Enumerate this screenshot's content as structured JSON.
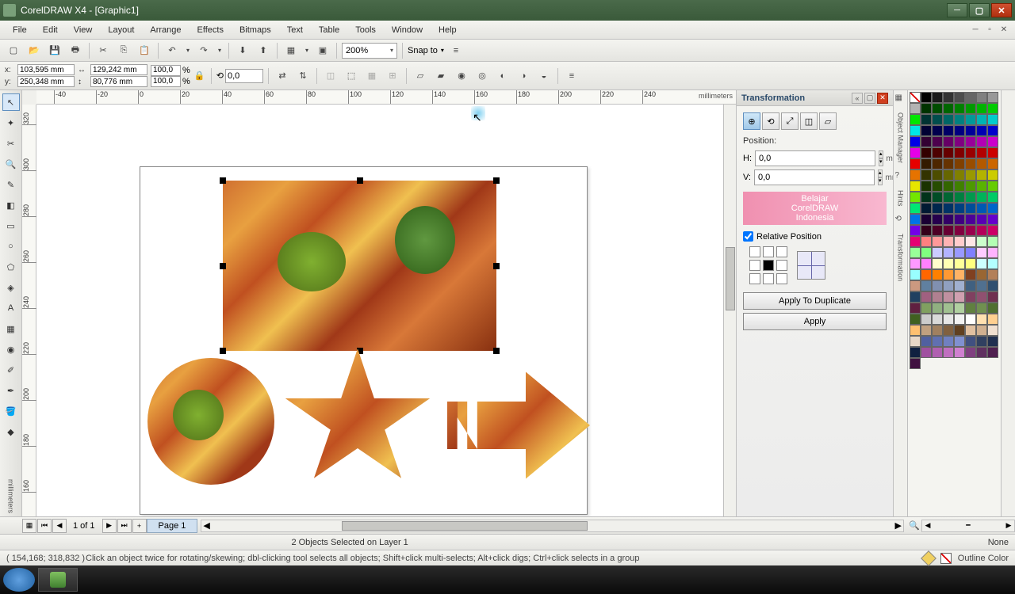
{
  "title": "CorelDRAW X4 - [Graphic1]",
  "menu": [
    "File",
    "Edit",
    "View",
    "Layout",
    "Arrange",
    "Effects",
    "Bitmaps",
    "Text",
    "Table",
    "Tools",
    "Window",
    "Help"
  ],
  "toolbar": {
    "zoom": "200%",
    "snap": "Snap to"
  },
  "prop": {
    "x": "103,595 mm",
    "y": "250,348 mm",
    "w": "129,242 mm",
    "h": "80,776 mm",
    "sx": "100,0",
    "sy": "100,0",
    "su": "%",
    "rot": "0,0"
  },
  "ruler": {
    "unit": "millimeters",
    "h": [
      -40,
      -20,
      0,
      20,
      40,
      60,
      80,
      100,
      120,
      140,
      160,
      180,
      200,
      220,
      240
    ],
    "v": [
      320,
      300,
      280,
      260,
      240,
      220,
      200,
      180,
      160
    ]
  },
  "docker": {
    "title": "Transformation",
    "section": "Position:",
    "h_label": "H:",
    "h_val": "0,0",
    "v_label": "V:",
    "v_val": "0,0",
    "unit": "mm",
    "banner": [
      "Belajar",
      "CorelDRAW",
      "Indonesia"
    ],
    "rel": "Relative Position",
    "btn_dup": "Apply To Duplicate",
    "btn_apply": "Apply"
  },
  "side_tabs": [
    "Object Manager",
    "Hints",
    "Transformation"
  ],
  "page": {
    "nav": "1 of 1",
    "tab": "Page 1"
  },
  "status": {
    "sel": "2 Objects Selected on Layer 1"
  },
  "hint": {
    "coords": "( 154,168; 318,832 )",
    "text": "Click an object twice for rotating/skewing; dbl-clicking tool selects all objects; Shift+click multi-selects; Alt+click digs; Ctrl+click selects in a group",
    "fill_none": "None",
    "outline": "Outline Color"
  },
  "palette": [
    "#000000",
    "#1a1a1a",
    "#333333",
    "#4d4d4d",
    "#666666",
    "#808080",
    "#999999",
    "#b3b3b3",
    "#003300",
    "#004d00",
    "#006600",
    "#008000",
    "#009900",
    "#00b300",
    "#00cc00",
    "#00e600",
    "#003333",
    "#004d4d",
    "#006666",
    "#008080",
    "#009999",
    "#00b3b3",
    "#00cccc",
    "#00e6e6",
    "#000033",
    "#00004d",
    "#000066",
    "#000080",
    "#000099",
    "#0000b3",
    "#0000cc",
    "#0000e6",
    "#330033",
    "#4d004d",
    "#660066",
    "#800080",
    "#990099",
    "#b300b3",
    "#cc00cc",
    "#e600e6",
    "#330000",
    "#4d0000",
    "#660000",
    "#800000",
    "#990000",
    "#b30000",
    "#cc0000",
    "#e60000",
    "#331a00",
    "#4d2600",
    "#663300",
    "#804000",
    "#994d00",
    "#b35900",
    "#cc6600",
    "#e67300",
    "#333300",
    "#4d4d00",
    "#666600",
    "#808000",
    "#999900",
    "#b3b300",
    "#cccc00",
    "#e6e600",
    "#1a3300",
    "#264d00",
    "#336600",
    "#408000",
    "#4d9900",
    "#59b300",
    "#66cc00",
    "#73e600",
    "#00331a",
    "#004d26",
    "#006633",
    "#008040",
    "#00994d",
    "#00b359",
    "#00cc66",
    "#00e673",
    "#001a33",
    "#00264d",
    "#003366",
    "#004080",
    "#004d99",
    "#0059b3",
    "#0066cc",
    "#0073e6",
    "#1a0033",
    "#26004d",
    "#330066",
    "#400080",
    "#4d0099",
    "#5900b3",
    "#6600cc",
    "#7300e6",
    "#33001a",
    "#4d0026",
    "#660033",
    "#800040",
    "#99004d",
    "#b30059",
    "#cc0066",
    "#e60073",
    "#ff8080",
    "#ff9999",
    "#ffb3b3",
    "#ffcccc",
    "#ffe6e6",
    "#ccffcc",
    "#b3ffb3",
    "#99ff99",
    "#80ff80",
    "#ccccff",
    "#b3b3ff",
    "#9999ff",
    "#8080ff",
    "#ffccff",
    "#ffb3ff",
    "#ff99ff",
    "#ff80ff",
    "#ffffcc",
    "#ffffb3",
    "#ffff99",
    "#ffff80",
    "#ccffff",
    "#b3ffff",
    "#99ffff",
    "#ff6600",
    "#ff8000",
    "#ff9933",
    "#ffb366",
    "#804020",
    "#996633",
    "#b38059",
    "#cc9980",
    "#6080a0",
    "#8090b0",
    "#90a0c0",
    "#a0b0d0",
    "#406080",
    "#507090",
    "#305070",
    "#204060",
    "#a06080",
    "#b08090",
    "#c090a0",
    "#d0a0b0",
    "#804060",
    "#905070",
    "#703050",
    "#602040",
    "#80a060",
    "#90b080",
    "#a0c090",
    "#b0d0a0",
    "#608040",
    "#709050",
    "#507030",
    "#406020",
    "#cccccc",
    "#d9d9d9",
    "#e6e6e6",
    "#f2f2f2",
    "#ffffff",
    "#ffe0b0",
    "#ffd090",
    "#ffc070",
    "#c0a080",
    "#a08060",
    "#806040",
    "#604020",
    "#e0c0a0",
    "#d0b090",
    "#f0e0d0",
    "#e8d8c8",
    "#5060a0",
    "#6070b0",
    "#7080c0",
    "#8090d0",
    "#405080",
    "#304060",
    "#203050",
    "#102040",
    "#a050a0",
    "#b060b0",
    "#c070c0",
    "#d080d0",
    "#804080",
    "#603060",
    "#502050",
    "#401040"
  ]
}
